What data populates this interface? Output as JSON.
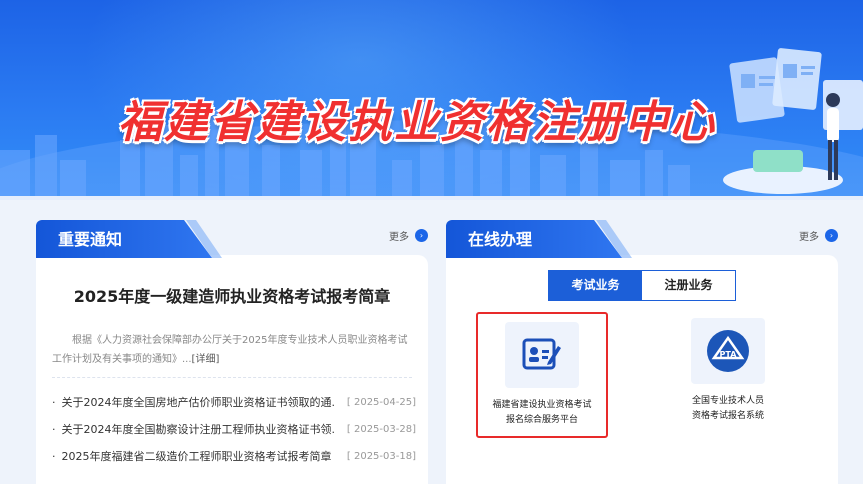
{
  "banner": {
    "title": "福建省建设执业资格注册中心"
  },
  "notice": {
    "tab_label": "重要通知",
    "more_label": "更多",
    "headline": "2025年度一级建造师执业资格考试报考简章",
    "summary": "根据《人力资源社会保障部办公厅关于2025年度专业技术人员职业资格考试工作计划及有关事项的通知》...",
    "detail_link": "[详细]",
    "items": [
      {
        "title": "关于2024年度全国房地产估价师职业资格证书领取的通...",
        "date": "[ 2025-04-25]"
      },
      {
        "title": "关于2024年度全国勘察设计注册工程师执业资格证书领...",
        "date": "[ 2025-03-28]"
      },
      {
        "title": "2025年度福建省二级造价工程师职业资格考试报考简章",
        "date": "[ 2025-03-18]"
      }
    ]
  },
  "online": {
    "tab_label": "在线办理",
    "more_label": "更多",
    "tabs": [
      {
        "label": "考试业务",
        "active": true
      },
      {
        "label": "注册业务",
        "active": false
      }
    ],
    "services": [
      {
        "line1": "福建省建设执业资格考试",
        "line2": "报名综合服务平台",
        "icon": "edit-form-icon"
      },
      {
        "line1": "全国专业技术人员",
        "line2": "资格考试报名系统",
        "icon": "pta-logo-icon",
        "logo_text": "PTA"
      }
    ]
  },
  "colors": {
    "primary": "#1c5fd8",
    "title_red": "#f03030",
    "highlight_border": "#e82a2a"
  }
}
